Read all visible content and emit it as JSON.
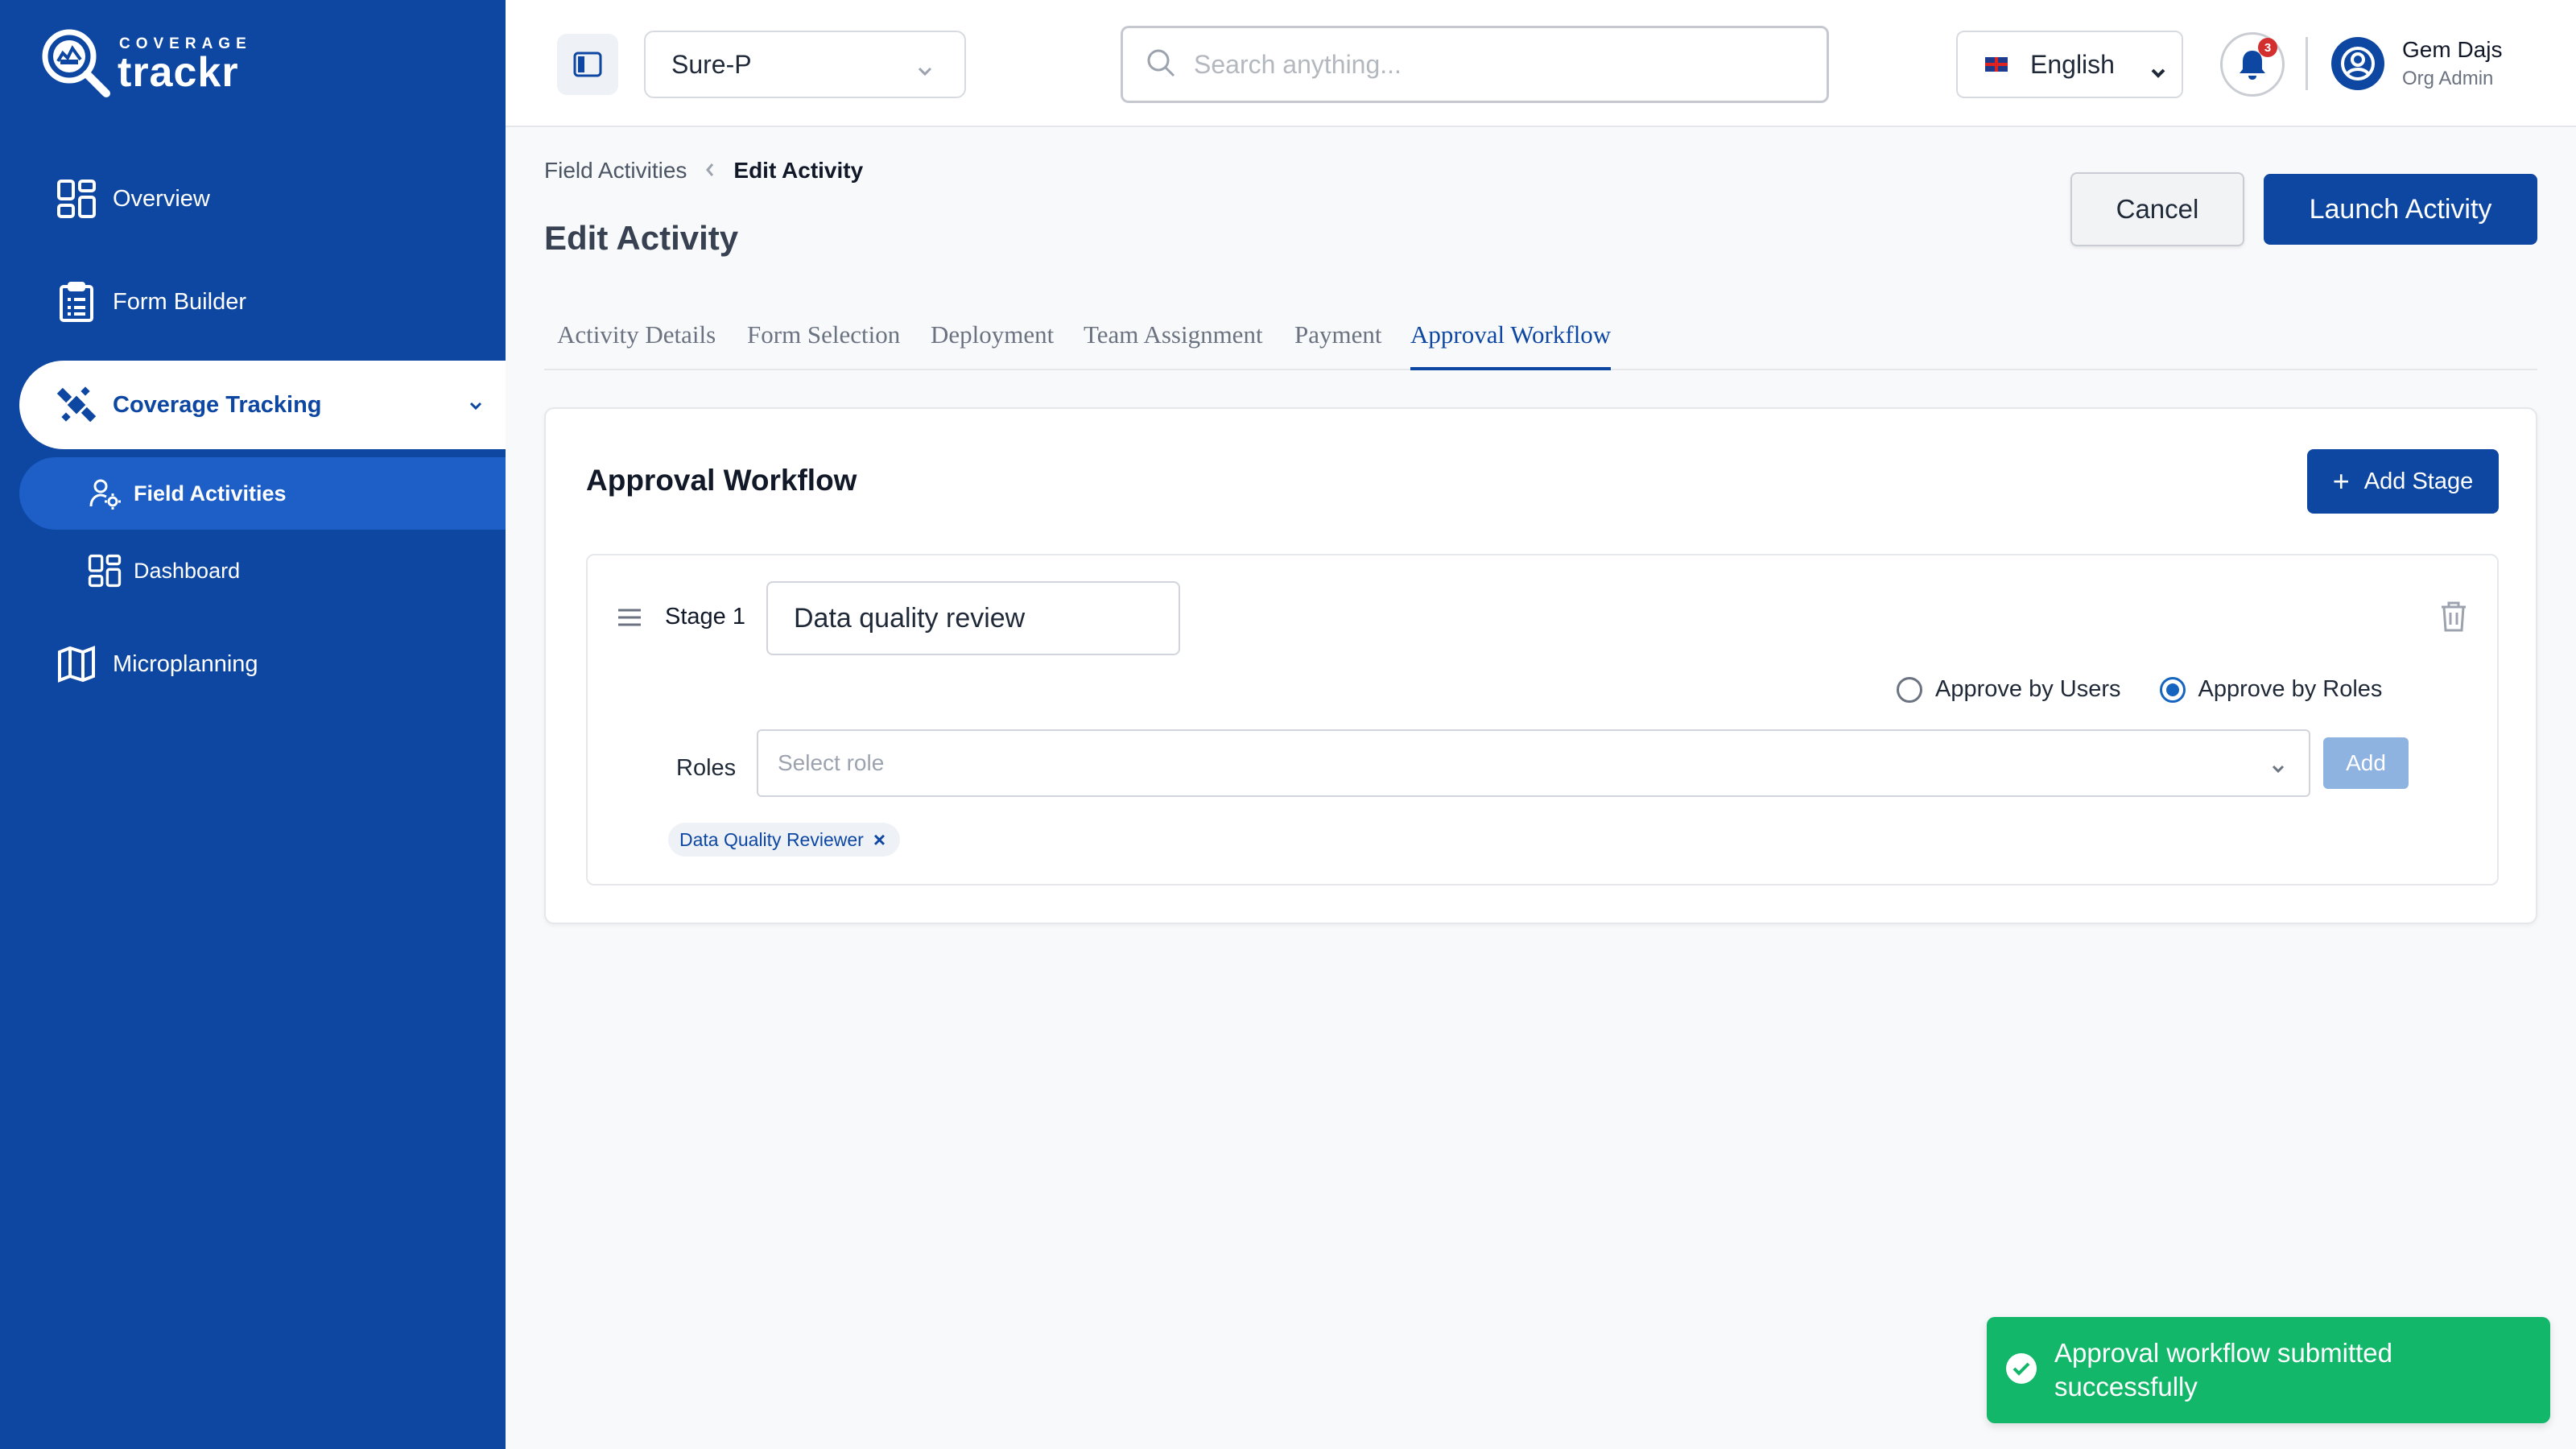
{
  "brand": {
    "tagline": "COVERAGE",
    "name": "trackr"
  },
  "sidebar": {
    "items": [
      {
        "label": "Overview",
        "icon": "grid-icon"
      },
      {
        "label": "Form Builder",
        "icon": "clipboard-icon"
      },
      {
        "label": "Coverage Tracking",
        "icon": "satellite-icon",
        "expanded": true,
        "children": [
          {
            "label": "Field Activities",
            "icon": "user-gear-icon",
            "active": true
          },
          {
            "label": "Dashboard",
            "icon": "grid-icon"
          }
        ]
      },
      {
        "label": "Microplanning",
        "icon": "map-icon"
      }
    ]
  },
  "header": {
    "org_select": {
      "value": "Sure-P"
    },
    "search": {
      "placeholder": "Search anything..."
    },
    "language": {
      "value": "English"
    },
    "notifications": {
      "count": "3"
    },
    "user": {
      "name": "Gem Dajs",
      "role": "Org Admin"
    }
  },
  "breadcrumb": {
    "parent": "Field Activities",
    "current": "Edit Activity"
  },
  "page": {
    "title": "Edit Activity",
    "cancel_label": "Cancel",
    "launch_label": "Launch Activity"
  },
  "tabs": [
    {
      "label": "Activity Details"
    },
    {
      "label": "Form Selection"
    },
    {
      "label": "Deployment"
    },
    {
      "label": "Team Assignment"
    },
    {
      "label": "Payment"
    },
    {
      "label": "Approval Workflow",
      "active": true
    }
  ],
  "workflow": {
    "title": "Approval Workflow",
    "add_stage_label": "Add Stage",
    "stages": [
      {
        "label": "Stage 1",
        "name_value": "Data quality review",
        "options": {
          "by_users": "Approve by Users",
          "by_roles": "Approve by Roles",
          "selected": "by_roles"
        },
        "roles_label": "Roles",
        "roles_placeholder": "Select role",
        "add_label": "Add",
        "selected_roles": [
          "Data Quality Reviewer"
        ]
      }
    ]
  },
  "toast": {
    "message": "Approval workflow submitted successfully"
  },
  "colors": {
    "primary": "#0d47a1",
    "success": "#12b76a",
    "badge": "#d32f2f"
  }
}
